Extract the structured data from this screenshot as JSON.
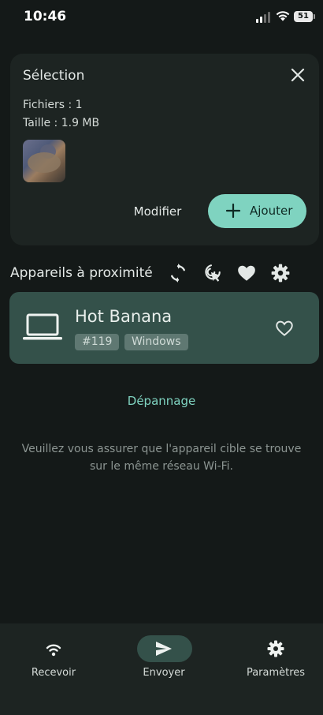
{
  "status_bar": {
    "time": "10:46",
    "battery": "51"
  },
  "selection": {
    "title": "Sélection",
    "files_line": "Fichiers : 1",
    "size_line": "Taille : 1.9 MB",
    "modify_label": "Modifier",
    "add_label": "Ajouter"
  },
  "nearby": {
    "title": "Appareils à proximité",
    "tools": [
      "refresh-icon",
      "scan-target-icon",
      "favorites-heart-icon",
      "settings-gear-icon"
    ]
  },
  "device": {
    "name": "Hot Banana",
    "id_tag": "#119",
    "os_tag": "Windows",
    "icon": "laptop-icon"
  },
  "troubleshoot_label": "Dépannage",
  "hint_text": "Veuillez vous assurer que l'appareil cible se trouve sur le même réseau Wi-Fi.",
  "nav": {
    "items": [
      {
        "label": "Recevoir",
        "icon": "wifi-icon"
      },
      {
        "label": "Envoyer",
        "icon": "send-icon"
      },
      {
        "label": "Paramètres",
        "icon": "gear-icon"
      }
    ],
    "active_index": 1
  },
  "colors": {
    "background": "#141918",
    "card": "#1d2422",
    "accent": "#7fd3c0",
    "device_card": "#34514a"
  }
}
